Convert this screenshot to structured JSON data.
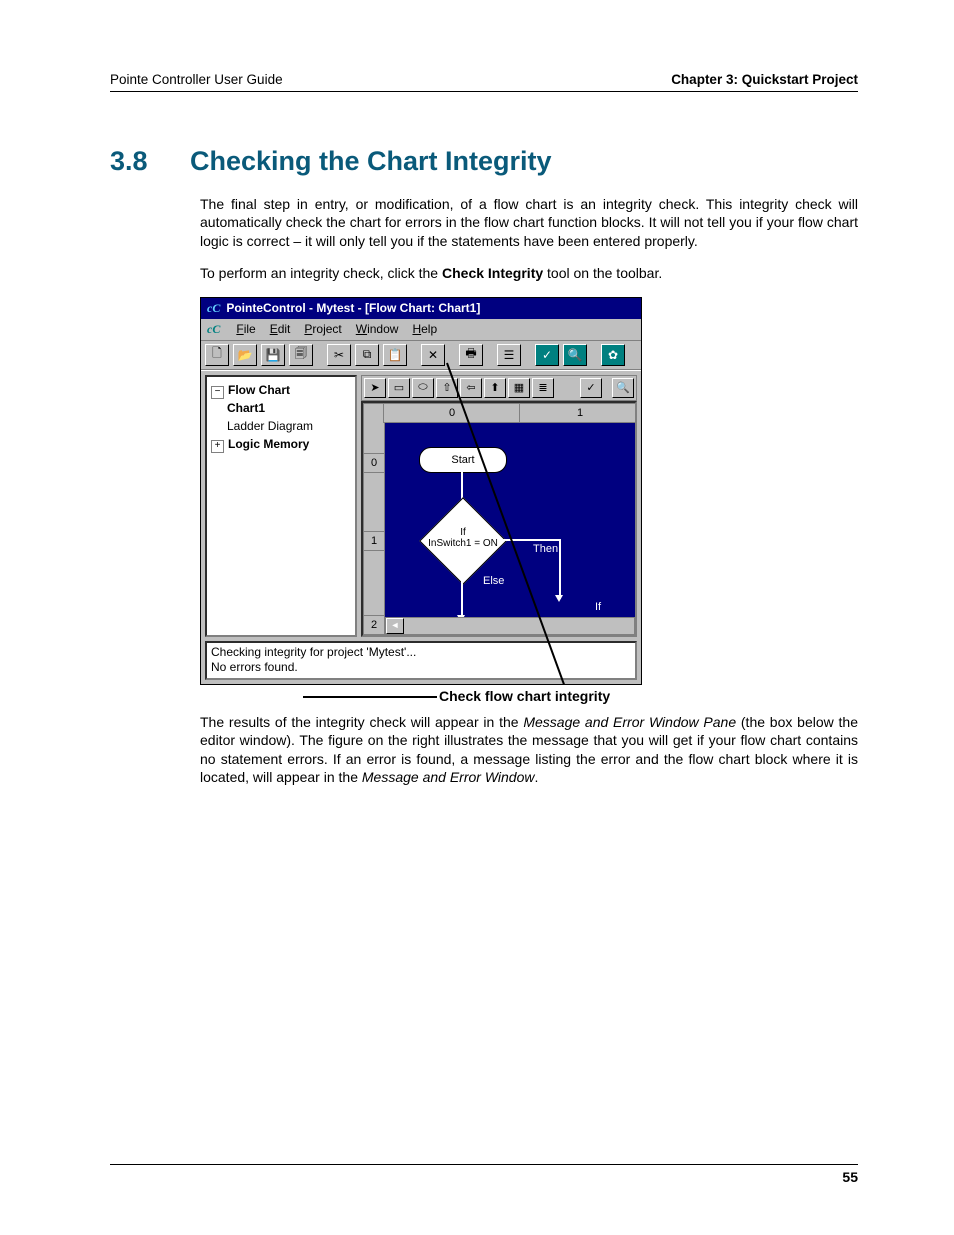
{
  "header": {
    "left": "Pointe Controller User Guide",
    "right": "Chapter 3: Quickstart Project"
  },
  "heading": {
    "number": "3.8",
    "title": "Checking the Chart Integrity"
  },
  "paragraphs": {
    "p1": "The final step in entry, or modification, of a flow chart is an integrity check. This integrity check will automatically check the chart for errors in the flow chart function blocks. It will not tell you if your flow chart logic is correct – it will only tell you if the statements have been entered properly.",
    "p2_pre": "To perform an integrity check, click the ",
    "p2_bold": "Check Integrity",
    "p2_post": " tool on the toolbar.",
    "p3_a": "The results of the integrity check will appear in the ",
    "p3_i1": "Message and Error Window Pane",
    "p3_b": " (the box below the editor window). The figure on the right illustrates the message that you will get if your flow chart contains no statement errors. If an error is found, a message listing the error and the flow chart block where it is located, will appear in the ",
    "p3_i2": "Message and Error Window",
    "p3_c": "."
  },
  "screenshot": {
    "title_logo": "cC",
    "title": "PointeControl - Mytest - [Flow Chart: Chart1]",
    "menu_logo": "cC",
    "menus": {
      "file": "File",
      "file_u": "F",
      "edit": "Edit",
      "edit_u": "E",
      "project": "Project",
      "project_u": "P",
      "window": "Window",
      "window_u": "W",
      "help": "Help",
      "help_u": "H"
    },
    "toolbar_icons": {
      "new": "🗋",
      "open": "📂",
      "save": "💾",
      "saveall": "🗐",
      "cut": "✂",
      "copy": "⧉",
      "paste": "📋",
      "delete": "✕",
      "print": "🖶",
      "props": "☰",
      "check": "✓",
      "find": "🔍",
      "pref": "✿"
    },
    "fc_toolbar_icons": {
      "pointer": "➤",
      "rect": "▭",
      "round": "⬭",
      "up": "⇧",
      "left": "⇦",
      "upr": "⬆",
      "grid": "▦",
      "list": "≣",
      "check": "✓",
      "zoom": "🔍"
    },
    "tree": {
      "flowchart": "Flow Chart",
      "chart1": "Chart1",
      "ladder": "Ladder Diagram",
      "logicmem": "Logic Memory",
      "minus": "−",
      "plus": "+"
    },
    "canvas": {
      "col0": "0",
      "col1": "1",
      "row0": "0",
      "row1": "1",
      "row2": "2",
      "start": "Start",
      "if": "If",
      "cond": "InSwitch1 = ON",
      "then": "Then",
      "else": "Else",
      "if2": "If",
      "scroll_left": "◄"
    },
    "messages": {
      "line1": "Checking integrity for project 'Mytest'...",
      "line2": "No errors found."
    },
    "callout": "Check flow chart integrity"
  },
  "page_number": "55"
}
